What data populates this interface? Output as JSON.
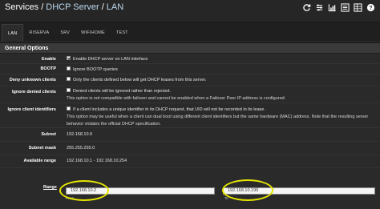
{
  "breadcrumb": {
    "level1": "Services",
    "level2": "DHCP Server",
    "level3": "LAN"
  },
  "tabs": [
    "LAN",
    "RISERVA",
    "SRV",
    "WIFIHOME",
    "TEST"
  ],
  "panel": {
    "title": "General Options"
  },
  "fields": {
    "enable": {
      "label": "Enable",
      "text": "Enable DHCP server on LAN interface",
      "checked": true
    },
    "bootp": {
      "label": "BOOTP",
      "text": "Ignore BOOTP queries",
      "checked": false
    },
    "deny_unknown": {
      "label": "Deny unknown clients",
      "text": "Only the clients defined below will get DHCP leases from this server.",
      "checked": false
    },
    "ignore_denied": {
      "label": "Ignore denied clients",
      "text": "Denied clients will be ignored rather than rejected.",
      "help": "This option is not compatible with failover and cannot be enabled when a Failover Peer IP address is configured.",
      "checked": false
    },
    "ignore_identifiers": {
      "label": "Ignore client identifiers",
      "text": "If a client includes a unique identifier in its DHCP request, that UID will not be recorded in its lease.",
      "help": "This option may be useful when a client can dual boot using different client identifiers but the same hardware (MAC) address. Note that the resulting server behavior violates the official DHCP specification.",
      "checked": false
    },
    "subnet": {
      "label": "Subnet",
      "value": "192.168.10.0"
    },
    "subnet_mask": {
      "label": "Subnet mask",
      "value": "255.255.255.0"
    },
    "available_range": {
      "label": "Available range",
      "value": "192.168.10.1 - 192.168.10.254"
    },
    "range": {
      "label": "Range",
      "from": "192.168.10.2",
      "to": "192.168.10.199",
      "from_label": "From",
      "to_label": "To"
    }
  },
  "colors": {
    "background": "#1e1e1e",
    "panel": "#2a2a2a",
    "highlight": "#e6e600",
    "breadcrumb_active": "#bcd8ee"
  },
  "header_icons": [
    "reload-icon",
    "settings-sliders-icon",
    "chart-icon",
    "list-icon",
    "table-icon",
    "help-icon"
  ]
}
